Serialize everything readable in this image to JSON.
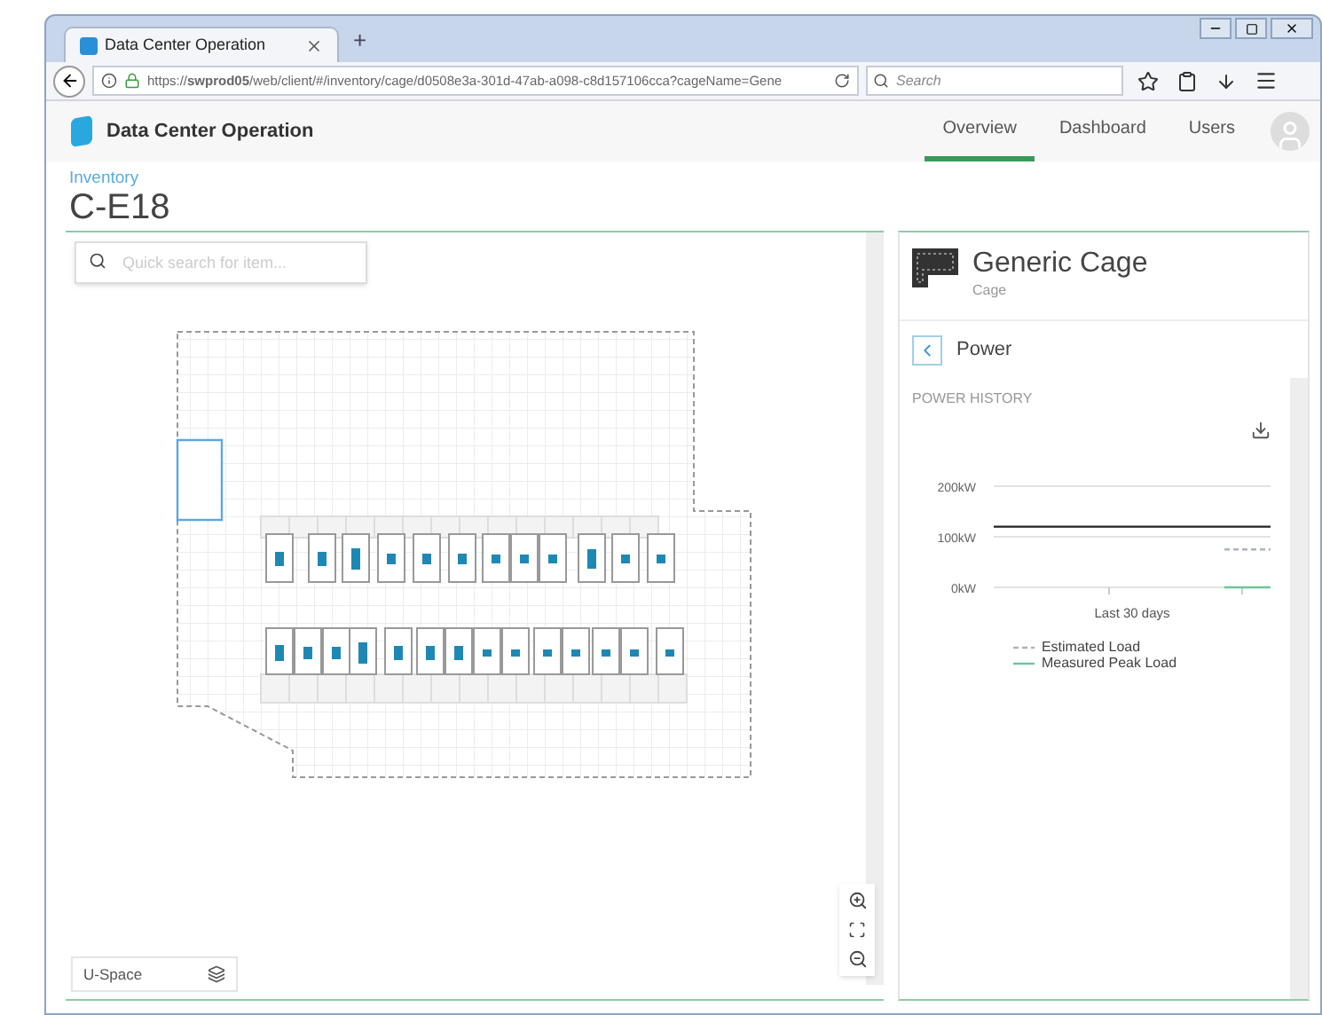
{
  "browser": {
    "tab_title": "Data Center Operation",
    "new_tab": "+",
    "url": "https://**swprod05**/web/client/#/inventory/cage/d0508e3a-301d-47ab-a098-c8d157106cca?cageName=Gene",
    "search_placeholder": "Search"
  },
  "app": {
    "title": "Data Center Operation",
    "nav": [
      {
        "label": "Overview",
        "selected": true
      },
      {
        "label": "Dashboard",
        "selected": false
      },
      {
        "label": "Users",
        "selected": false
      }
    ]
  },
  "breadcrumb": "Inventory",
  "page_title": "C-E18",
  "floor_plan": {
    "search_placeholder": "Quick search for item...",
    "layer_label": "U-Space"
  },
  "details": {
    "title": "Generic Cage",
    "subtitle": "Cage",
    "section": "Power",
    "heading": "POWER HISTORY",
    "chart_data": {
      "type": "line",
      "xlabel": "Last 30 days",
      "ylim": [
        0,
        200
      ],
      "yticks": [
        {
          "value": 0,
          "label": "0kW"
        },
        {
          "value": 100,
          "label": "100kW"
        },
        {
          "value": 200,
          "label": "200kW"
        }
      ],
      "series": [
        {
          "color": "#222222",
          "line_style": "solid",
          "values": [
            120,
            120,
            120,
            120,
            120,
            120,
            120
          ]
        },
        {
          "name": "Estimated Load",
          "color": "#a9b3c1",
          "line_style": "dashed",
          "values": [
            null,
            null,
            null,
            null,
            null,
            75,
            75
          ]
        },
        {
          "name": "Measured Peak Load",
          "color": "#6cc59c",
          "line_style": "solid",
          "values": [
            null,
            null,
            null,
            null,
            null,
            0,
            0
          ]
        }
      ]
    }
  }
}
